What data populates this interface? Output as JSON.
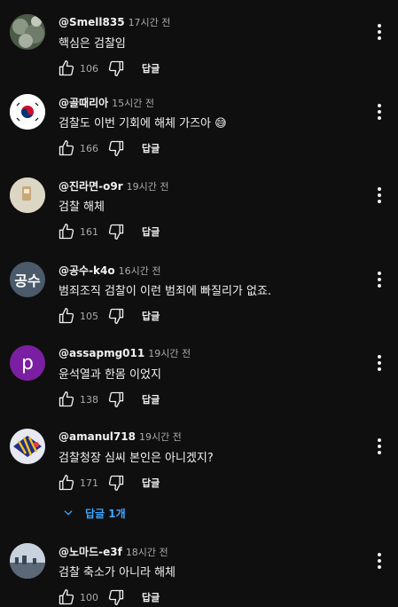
{
  "comments": [
    {
      "author": "@Smell835",
      "time": "17시간 전",
      "text": "핵심은 검찰임",
      "likes": "106",
      "reply": "답글",
      "avatar": {
        "kind": "photo",
        "color": "#6b7a68"
      }
    },
    {
      "author": "@골때리아",
      "time": "15시간 전",
      "text": "검찰도 이번 기회에 해체 가즈아 😅",
      "likes": "166",
      "reply": "답글",
      "avatar": {
        "kind": "flag",
        "color": "#ffffff"
      }
    },
    {
      "author": "@진라면-o9r",
      "time": "19시간 전",
      "text": "검찰 해체",
      "likes": "161",
      "reply": "답글",
      "avatar": {
        "kind": "photo",
        "color": "#d8d2c0"
      }
    },
    {
      "author": "@공수-k4o",
      "time": "16시간 전",
      "text": "범죄조직 검찰이 이런 범죄에 빠질리가 없죠.",
      "likes": "105",
      "reply": "답글",
      "avatar": {
        "kind": "text",
        "label": "공수",
        "color": "#4a5a6a"
      }
    },
    {
      "author": "@assapmg011",
      "time": "19시간 전",
      "text": "윤석열과 한몸 이었지",
      "likes": "138",
      "reply": "답글",
      "avatar": {
        "kind": "letter",
        "label": "p",
        "color": "#7b1fa2"
      }
    },
    {
      "author": "@amanul718",
      "time": "19시간 전",
      "text": "검찰청장 심씨 본인은 아니겠지?",
      "likes": "171",
      "reply": "답글",
      "avatar": {
        "kind": "photo",
        "color": "#3a4a8a"
      }
    },
    {
      "author": "@노마드-e3f",
      "time": "18시간 전",
      "text": "검찰 축소가 아니라 해체",
      "likes": "100",
      "reply": "답글",
      "avatar": {
        "kind": "photo",
        "color": "#8a96a8"
      }
    }
  ],
  "replies_toggle": {
    "label": "답글 1개"
  },
  "colors": {
    "background": "#0f0f0f",
    "text": "#f1f1f1",
    "secondary": "#aaaaaa",
    "link": "#3ea6ff"
  },
  "icons": [
    "thumb-up-icon",
    "thumb-down-icon",
    "more-vert-icon",
    "chevron-down-icon"
  ]
}
